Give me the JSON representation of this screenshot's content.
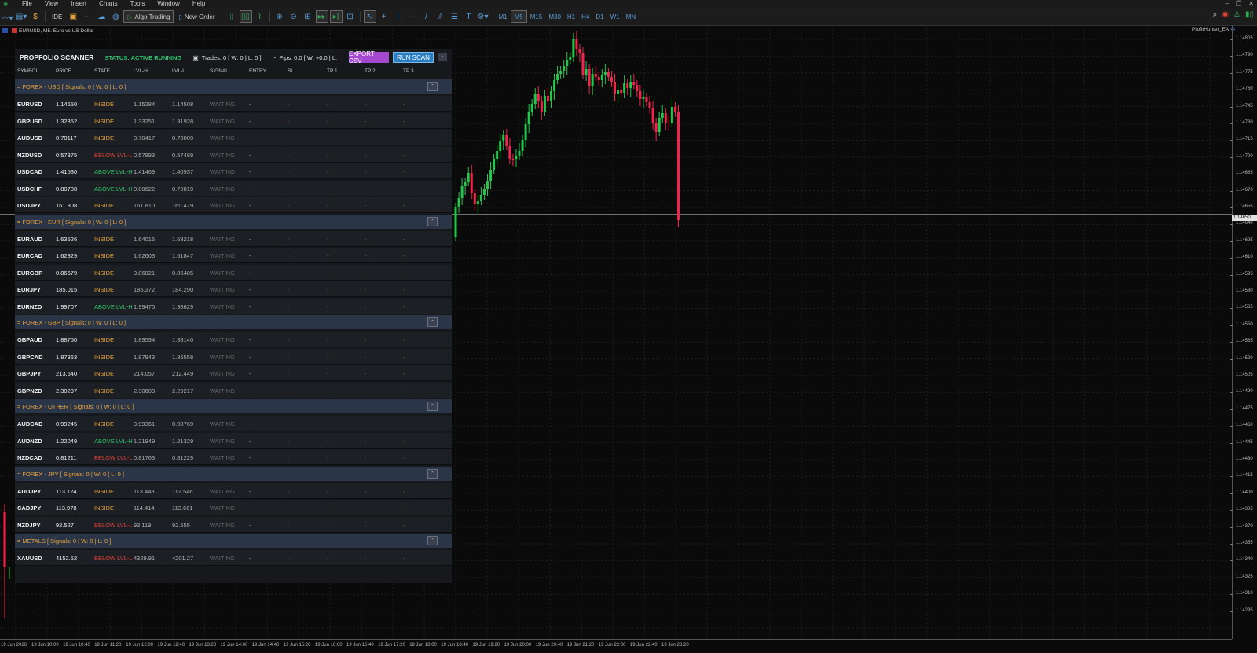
{
  "menu": [
    "File",
    "View",
    "Insert",
    "Charts",
    "Tools",
    "Window",
    "Help"
  ],
  "toolbar": {
    "algo_label": "Algo Trading",
    "order_label": "New Order",
    "ide_label": "IDE",
    "timeframes": [
      "M1",
      "M5",
      "M15",
      "M30",
      "H1",
      "H4",
      "D1",
      "W1",
      "MN"
    ],
    "active_timeframe": "M5"
  },
  "chart": {
    "symbol_desc": "EURUSD, M5:  Euro vs US Dollar",
    "ea_name": "ProfitHunter_EA",
    "current_price": "1.14650",
    "colors": {
      "bull": "#22c84a",
      "bear": "#f0244c",
      "grid": "#1f1f1f"
    }
  },
  "price_axis": [
    "1.14805",
    "1.14790",
    "1.14775",
    "1.14760",
    "1.14745",
    "1.14730",
    "1.14715",
    "1.14700",
    "1.14685",
    "1.14670",
    "1.14655",
    "1.14640",
    "1.14625",
    "1.14610",
    "1.14595",
    "1.14580",
    "1.14565",
    "1.14550",
    "1.14535",
    "1.14520",
    "1.14505",
    "1.14490",
    "1.14475",
    "1.14460",
    "1.14445",
    "1.14430",
    "1.14415",
    "1.14400",
    "1.14385",
    "1.14370",
    "1.14355",
    "1.14340",
    "1.14325",
    "1.14310",
    "1.14295"
  ],
  "time_axis": [
    "19 Jun 2026",
    "19 Jun 10:00",
    "19 Jun 10:40",
    "19 Jun 11:20",
    "19 Jun 12:00",
    "19 Jun 12:40",
    "19 Jun 13:20",
    "19 Jun 14:00",
    "19 Jun 14:40",
    "19 Jun 15:20",
    "19 Jun 16:00",
    "19 Jun 16:40",
    "19 Jun 17:20",
    "19 Jun 18:00",
    "19 Jun 18:40",
    "19 Jun 19:20",
    "19 Jun 20:00",
    "19 Jun 20:40",
    "19 Jun 21:20",
    "19 Jun 22:00",
    "19 Jun 22:40",
    "19 Jun 23:20"
  ],
  "scanner": {
    "title": "PROPFOLIO SCANNER",
    "status": "STATUS: ACTIVE RUNNING",
    "trades": "Trades: 0  [ W: 0  |  L: 0 ]",
    "pips": "Pips: 0.0  [ W: +0.0  |  L:",
    "export_label": "EXPORT CSV",
    "scan_label": "RUN SCAN",
    "min_label": "-",
    "columns": [
      "SYMBOL",
      "PRICE",
      "STATE",
      "LVL-H",
      "LVL-L",
      "SIGNAL",
      "ENTRY",
      "SL",
      "TP 1",
      "TP 2",
      "TP 3"
    ],
    "state_colors": {
      "INSIDE": "#e8a23a",
      "BELOW LVL-L": "#e0453a",
      "ABOVE LVL-H": "#2fc26a"
    },
    "groups": [
      {
        "label": "= FOREX - USD   [ Signals: 0   |   W: 0   |   L: 0 ]",
        "btn": "-",
        "rows": [
          [
            "EURUSD",
            "1.14650",
            "INSIDE",
            "1.15284",
            "1.14508",
            "WAITING",
            "-",
            "-",
            "-",
            "-",
            "-"
          ],
          [
            "GBPUSD",
            "1.32352",
            "INSIDE",
            "1.33251",
            "1.31928",
            "WAITING",
            "-",
            "-",
            "-",
            "-",
            "-"
          ],
          [
            "AUDUSD",
            "0.70117",
            "INSIDE",
            "0.70417",
            "0.70009",
            "WAITING",
            "-",
            "-",
            "-",
            "-",
            "-"
          ],
          [
            "NZDUSD",
            "0.57375",
            "BELOW LVL-L",
            "0.57993",
            "0.57489",
            "WAITING",
            "-",
            "-",
            "-",
            "-",
            "-"
          ],
          [
            "USDCAD",
            "1.41530",
            "ABOVE LVL-H",
            "1.41469",
            "1.40937",
            "WAITING",
            "-",
            "-",
            "-",
            "-",
            "-"
          ],
          [
            "USDCHF",
            "0.80708",
            "ABOVE LVL-H",
            "0.80622",
            "0.79819",
            "WAITING",
            "-",
            "-",
            "-",
            "-",
            "-"
          ],
          [
            "USDJPY",
            "161.308",
            "INSIDE",
            "161.810",
            "160.479",
            "WAITING",
            "-",
            "-",
            "-",
            "-",
            "-"
          ]
        ]
      },
      {
        "label": "= FOREX - EUR   [ Signals: 0   |   W: 0   |   L: 0 ]",
        "btn": "-",
        "rows": [
          [
            "EURAUD",
            "1.63526",
            "INSIDE",
            "1.64015",
            "1.63218",
            "WAITING",
            "-",
            "-",
            "-",
            "-",
            "-"
          ],
          [
            "EURCAD",
            "1.62329",
            "INSIDE",
            "1.62603",
            "1.61847",
            "WAITING",
            "-",
            "-",
            "-",
            "-",
            "-"
          ],
          [
            "EURGBP",
            "0.86679",
            "INSIDE",
            "0.86821",
            "0.86485",
            "WAITING",
            "-",
            "-",
            "-",
            "-",
            "-"
          ],
          [
            "EURJPY",
            "185.015",
            "INSIDE",
            "185.372",
            "184.290",
            "WAITING",
            "-",
            "-",
            "-",
            "-",
            "-"
          ],
          [
            "EURNZD",
            "1.99707",
            "ABOVE LVL-H",
            "1.99475",
            "1.98629",
            "WAITING",
            "-",
            "-",
            "-",
            "-",
            "-"
          ]
        ]
      },
      {
        "label": "= FOREX - GBP   [ Signals: 0   |   W: 0   |   L: 0 ]",
        "btn": "-",
        "rows": [
          [
            "GBPAUD",
            "1.88750",
            "INSIDE",
            "1.89594",
            "1.88140",
            "WAITING",
            "-",
            "-",
            "-",
            "-",
            "-"
          ],
          [
            "GBPCAD",
            "1.87363",
            "INSIDE",
            "1.87943",
            "1.86558",
            "WAITING",
            "-",
            "-",
            "-",
            "-",
            "-"
          ],
          [
            "GBPJPY",
            "213.540",
            "INSIDE",
            "214.057",
            "212.449",
            "WAITING",
            "-",
            "-",
            "-",
            "-",
            "-"
          ],
          [
            "GBPNZD",
            "2.30297",
            "INSIDE",
            "2.30600",
            "2.29217",
            "WAITING",
            "-",
            "-",
            "-",
            "-",
            "-"
          ]
        ]
      },
      {
        "label": "= FOREX - OTHER   [ Signals: 0   |   W: 0   |   L: 0 ]",
        "btn": "-",
        "rows": [
          [
            "AUDCAD",
            "0.99245",
            "INSIDE",
            "0.99361",
            "0.98769",
            "WAITING",
            "-",
            "-",
            "-",
            "-",
            "-"
          ],
          [
            "AUDNZD",
            "1.22049",
            "ABOVE LVL-H",
            "1.21949",
            "1.21329",
            "WAITING",
            "-",
            "-",
            "-",
            "-",
            "-"
          ],
          [
            "NZDCAD",
            "0.81211",
            "BELOW LVL-L",
            "0.81763",
            "0.81229",
            "WAITING",
            "-",
            "-",
            "-",
            "-",
            "-"
          ]
        ]
      },
      {
        "label": "= FOREX - JPY   [ Signals: 0   |   W: 0   |   L: 0 ]",
        "btn": "-",
        "rows": [
          [
            "AUDJPY",
            "113.124",
            "INSIDE",
            "113.448",
            "112.546",
            "WAITING",
            "-",
            "-",
            "-",
            "-",
            "-"
          ],
          [
            "CADJPY",
            "113.978",
            "INSIDE",
            "114.414",
            "113.661",
            "WAITING",
            "-",
            "-",
            "-",
            "-",
            "-"
          ],
          [
            "NZDJPY",
            "92.527",
            "BELOW LVL-L",
            "93.119",
            "92.555",
            "WAITING",
            "-",
            "-",
            "-",
            "-",
            "-"
          ]
        ]
      },
      {
        "label": "= METALS   [ Signals: 0   |   W: 0   |   L: 0 ]",
        "btn": "-",
        "rows": [
          [
            "XAUUSD",
            "4152.52",
            "BELOW LVL-L",
            "4329.91",
            "4201.27",
            "WAITING",
            "-",
            "-",
            "-",
            "-",
            "-"
          ]
        ]
      }
    ]
  }
}
